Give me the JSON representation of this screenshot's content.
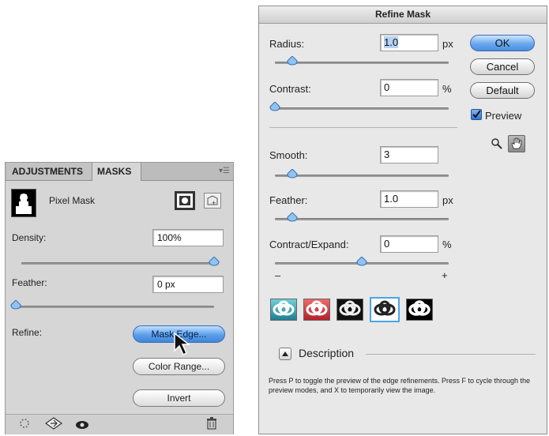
{
  "masks_panel": {
    "tabs": [
      "ADJUSTMENTS",
      "MASKS"
    ],
    "pixel_mask_label": "Pixel Mask",
    "density": {
      "label": "Density:",
      "value": "100%",
      "level": 1.0
    },
    "feather": {
      "label": "Feather:",
      "value": "0 px",
      "level": 0.0
    },
    "refine_label": "Refine:",
    "buttons": {
      "mask_edge": "Mask Edge...",
      "color_range": "Color Range...",
      "invert": "Invert"
    }
  },
  "refine_dialog": {
    "title": "Refine Mask",
    "fields": {
      "radius": {
        "label": "Radius:",
        "value": "1.0",
        "unit": "px",
        "level": 0.1
      },
      "contrast": {
        "label": "Contrast:",
        "value": "0",
        "unit": "%",
        "level": 0.0
      },
      "smooth": {
        "label": "Smooth:",
        "value": "3",
        "unit": "",
        "level": 0.1
      },
      "feather": {
        "label": "Feather:",
        "value": "1.0",
        "unit": "px",
        "level": 0.1
      },
      "contract_expand": {
        "label": "Contract/Expand:",
        "value": "0",
        "unit": "%",
        "level": 0.5
      }
    },
    "minus": "–",
    "plus": "+",
    "buttons": {
      "ok": "OK",
      "cancel": "Cancel",
      "default": "Default"
    },
    "preview": {
      "label": "Preview",
      "checked": true
    },
    "description_heading": "Description",
    "description_text": "Press P to toggle the preview of the edge refinements. Press F to cycle through the preview modes, and X to temporarily view the image."
  },
  "colors": {
    "accent_blue": "#4a8fe0",
    "panel_bg": "#d6d6d6",
    "dialog_bg": "#e8e8e8"
  }
}
